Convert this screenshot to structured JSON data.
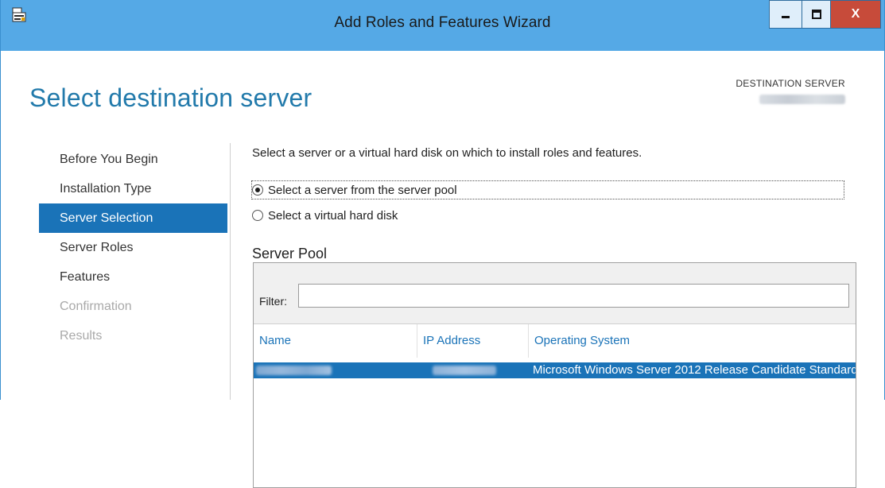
{
  "window": {
    "title": "Add Roles and Features Wizard",
    "controls": {
      "minimize": "_",
      "maximize": "□",
      "close": "X"
    }
  },
  "page": {
    "title": "Select destination server",
    "destination_label": "DESTINATION SERVER"
  },
  "nav": {
    "items": [
      {
        "label": "Before You Begin",
        "state": "normal"
      },
      {
        "label": "Installation Type",
        "state": "normal"
      },
      {
        "label": "Server Selection",
        "state": "active"
      },
      {
        "label": "Server Roles",
        "state": "normal"
      },
      {
        "label": "Features",
        "state": "normal"
      },
      {
        "label": "Confirmation",
        "state": "disabled"
      },
      {
        "label": "Results",
        "state": "disabled"
      }
    ]
  },
  "main": {
    "description": "Select a server or a virtual hard disk on which to install roles and features.",
    "options": [
      {
        "label": "Select a server from the server pool",
        "checked": true
      },
      {
        "label": "Select a virtual hard disk",
        "checked": false
      }
    ],
    "pool": {
      "title": "Server Pool",
      "filter_label": "Filter:",
      "filter_value": "",
      "columns": [
        "Name",
        "IP Address",
        "Operating System"
      ],
      "rows": [
        {
          "os": "Microsoft Windows Server 2012 Release Candidate Standard",
          "selected": true
        }
      ]
    }
  },
  "colors": {
    "accent": "#1a73b8",
    "title_blue": "#227aab",
    "titlebar": "#55a9e6",
    "close_button": "#c74b3a"
  }
}
